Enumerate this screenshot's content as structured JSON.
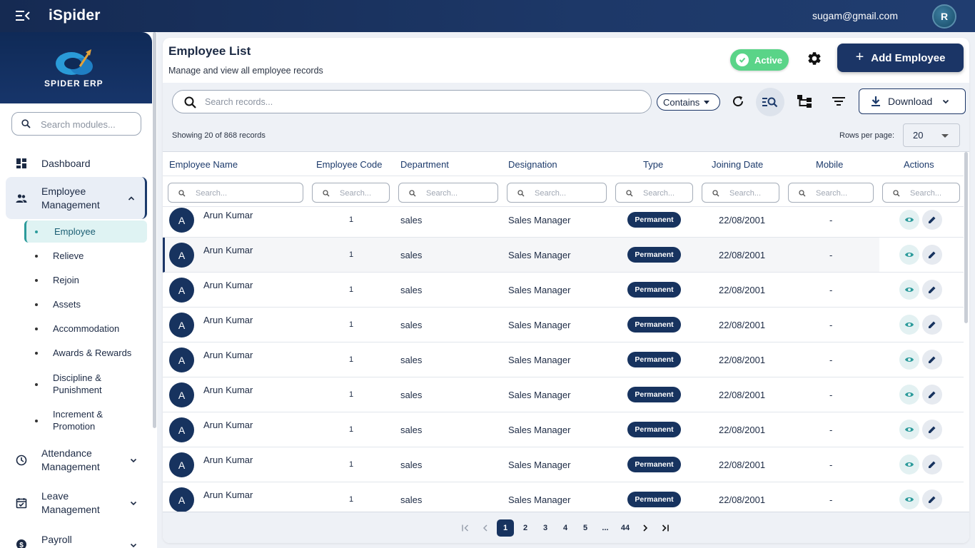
{
  "app": {
    "title": "iSpider",
    "user_email": "sugam@gmail.com",
    "avatar_initial": "R",
    "logo_text": "SPIDER ERP"
  },
  "sidebar": {
    "search_placeholder": "Search modules...",
    "dashboard": "Dashboard",
    "employee_management": "Employee Management",
    "sub_items": [
      "Employee",
      "Relieve",
      "Rejoin",
      "Assets",
      "Accommodation",
      "Awards & Rewards",
      "Discipline & Punishment",
      "Increment & Promotion"
    ],
    "attendance_management": "Attendance Management",
    "leave_management": "Leave Management",
    "payroll": "Payroll"
  },
  "header": {
    "title": "Employee List",
    "subtitle": "Manage and view all employee records",
    "status": "Active",
    "add_button": "Add Employee"
  },
  "toolbar": {
    "search_placeholder": "Search records...",
    "match_mode": "Contains",
    "download_label": "Download"
  },
  "info": {
    "showing": "Showing 20 of 868 records",
    "rows_per_page_label": "Rows per page:",
    "rows_per_page": "20"
  },
  "table": {
    "columns": [
      "Employee Name",
      "Employee Code",
      "Department",
      "Designation",
      "Type",
      "Joining Date",
      "Mobile",
      "Actions"
    ],
    "filter_placeholder": "Search...",
    "rows": [
      {
        "initial": "A",
        "name": "Arun Kumar",
        "code": "1",
        "department": "sales",
        "designation": "Sales Manager",
        "type": "Permanent",
        "joining_date": "22/08/2001",
        "mobile": "-"
      },
      {
        "initial": "A",
        "name": "Arun Kumar",
        "code": "1",
        "department": "sales",
        "designation": "Sales Manager",
        "type": "Permanent",
        "joining_date": "22/08/2001",
        "mobile": "-"
      },
      {
        "initial": "A",
        "name": "Arun Kumar",
        "code": "1",
        "department": "sales",
        "designation": "Sales Manager",
        "type": "Permanent",
        "joining_date": "22/08/2001",
        "mobile": "-"
      },
      {
        "initial": "A",
        "name": "Arun Kumar",
        "code": "1",
        "department": "sales",
        "designation": "Sales Manager",
        "type": "Permanent",
        "joining_date": "22/08/2001",
        "mobile": "-"
      },
      {
        "initial": "A",
        "name": "Arun Kumar",
        "code": "1",
        "department": "sales",
        "designation": "Sales Manager",
        "type": "Permanent",
        "joining_date": "22/08/2001",
        "mobile": "-"
      },
      {
        "initial": "A",
        "name": "Arun Kumar",
        "code": "1",
        "department": "sales",
        "designation": "Sales Manager",
        "type": "Permanent",
        "joining_date": "22/08/2001",
        "mobile": "-"
      },
      {
        "initial": "A",
        "name": "Arun Kumar",
        "code": "1",
        "department": "sales",
        "designation": "Sales Manager",
        "type": "Permanent",
        "joining_date": "22/08/2001",
        "mobile": "-"
      },
      {
        "initial": "A",
        "name": "Arun Kumar",
        "code": "1",
        "department": "sales",
        "designation": "Sales Manager",
        "type": "Permanent",
        "joining_date": "22/08/2001",
        "mobile": "-"
      },
      {
        "initial": "A",
        "name": "Arun Kumar",
        "code": "1",
        "department": "sales",
        "designation": "Sales Manager",
        "type": "Permanent",
        "joining_date": "22/08/2001",
        "mobile": "-"
      }
    ]
  },
  "pagination": {
    "pages": [
      "1",
      "2",
      "3",
      "4",
      "5",
      "...",
      "44"
    ],
    "current": "1"
  },
  "colors": {
    "primary": "#17335f",
    "active_green": "#5ad488",
    "accent_teal": "#2c9b9b"
  }
}
